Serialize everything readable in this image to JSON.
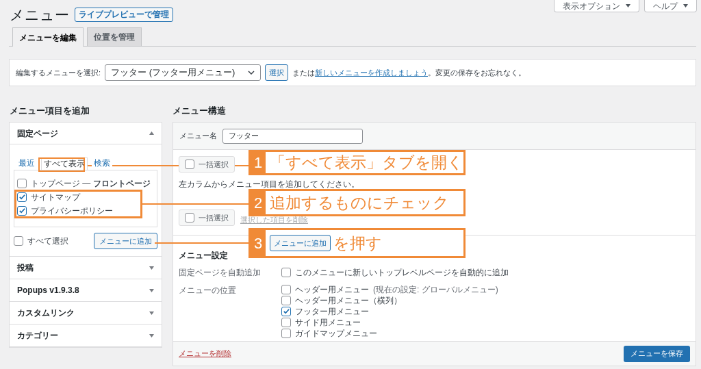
{
  "header": {
    "title": "メニュー",
    "live_preview_button": "ライブプレビューで管理",
    "screen_options": "表示オプション",
    "help": "ヘルプ"
  },
  "tabs": [
    {
      "label": "メニューを編集",
      "selected": true
    },
    {
      "label": "位置を管理",
      "selected": false
    }
  ],
  "menu_select": {
    "label": "編集するメニューを選択:",
    "value": "フッター (フッター用メニュー)",
    "button": "選択",
    "text_before": "または",
    "link": "新しいメニューを作成しましょう",
    "text_after": "。変更の保存をお忘れなく。"
  },
  "add_items": {
    "heading": "メニュー項目を追加",
    "sections": [
      {
        "title": "固定ページ",
        "expanded": true,
        "tabs": [
          {
            "label": "最近",
            "selected": false
          },
          {
            "label": "すべて表示",
            "selected": true
          },
          {
            "label": "検索",
            "selected": false
          }
        ],
        "items": [
          {
            "label": "トップページ — **フロントページ**",
            "checked": false
          },
          {
            "label": "サイトマップ",
            "checked": true
          },
          {
            "label": "プライバシーポリシー",
            "checked": true
          }
        ],
        "select_all": {
          "label": "すべて選択",
          "checked": false
        },
        "add_button": "メニューに追加"
      },
      {
        "title": "投稿",
        "expanded": false
      },
      {
        "title": "Popups v1.9.3.8",
        "expanded": false
      },
      {
        "title": "カスタムリンク",
        "expanded": false
      },
      {
        "title": "カテゴリー",
        "expanded": false
      }
    ]
  },
  "structure": {
    "heading": "メニュー構造",
    "name_label": "メニュー名",
    "name_value": "フッター",
    "bulk_selects": [
      {
        "label": "一括選択",
        "checked": false
      },
      {
        "label": "一括選択",
        "checked": false
      }
    ],
    "hint": "左カラムからメニュー項目を追加してください。",
    "delete_selected": "選択した項目を削除",
    "settings_heading": "メニュー設定",
    "auto_add_label": "固定ページを自動追加",
    "auto_add": {
      "label": "このメニューに新しいトップレベルページを自動的に追加",
      "checked": false
    },
    "location_label": "メニューの位置",
    "locations": [
      {
        "label": "ヘッダー用メニュー",
        "note": "(現在の設定: グローバルメニュー)",
        "checked": false
      },
      {
        "label": "ヘッダー用メニュー（横列）",
        "checked": false
      },
      {
        "label": "フッター用メニュー",
        "checked": true
      },
      {
        "label": "サイド用メニュー",
        "checked": false
      },
      {
        "label": "ガイドマップメニュー",
        "checked": false
      }
    ],
    "delete_link": "メニューを削除",
    "save_button": "メニューを保存"
  },
  "callouts": [
    {
      "number": "1",
      "text": "「すべて表示」タブを開く"
    },
    {
      "number": "2",
      "text": "追加するものにチェック"
    },
    {
      "number": "3",
      "button": "メニューに追加",
      "text": "を押す"
    }
  ]
}
